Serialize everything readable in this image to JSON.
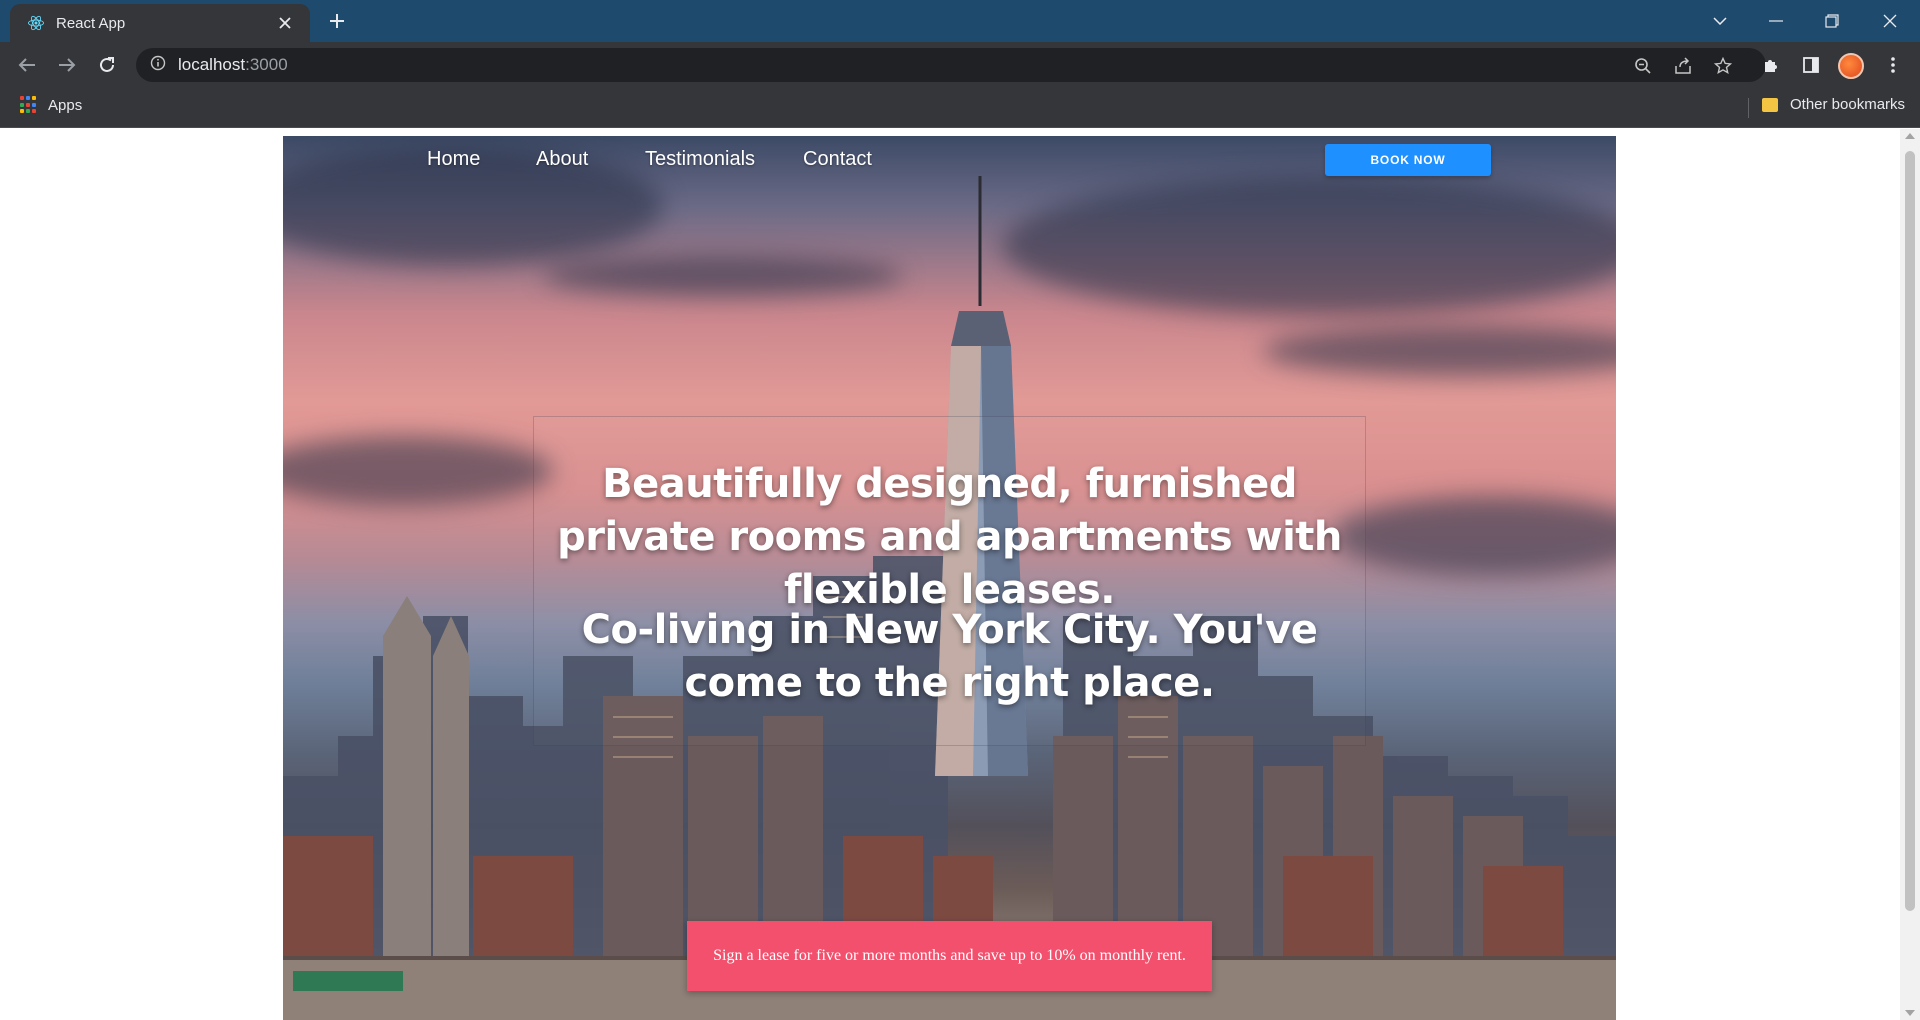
{
  "browser": {
    "tab_title": "React App",
    "tab_favicon": "react-logo-icon",
    "url_host": "localhost",
    "url_port": ":3000",
    "bookmarks": {
      "apps_label": "Apps",
      "other_label": "Other bookmarks"
    },
    "colors": {
      "titlebar": "#1e4a6e",
      "toolbar": "#35363a",
      "omnibox": "#202124"
    }
  },
  "page": {
    "nav": {
      "links": [
        "Home",
        "About",
        "Testimonials",
        "Contact"
      ],
      "cta_label": "BOOK NOW"
    },
    "hero": {
      "heading_primary": "Beautifully designed, furnished private rooms and apartments with flexible leases.",
      "heading_secondary": "Co-living in New York City. You've come to the right place."
    },
    "promo": {
      "text": "Sign a lease for five or more months and save up to 10% on monthly rent."
    },
    "colors": {
      "cta": "#1e90ff",
      "promo": "#f2506c"
    }
  }
}
